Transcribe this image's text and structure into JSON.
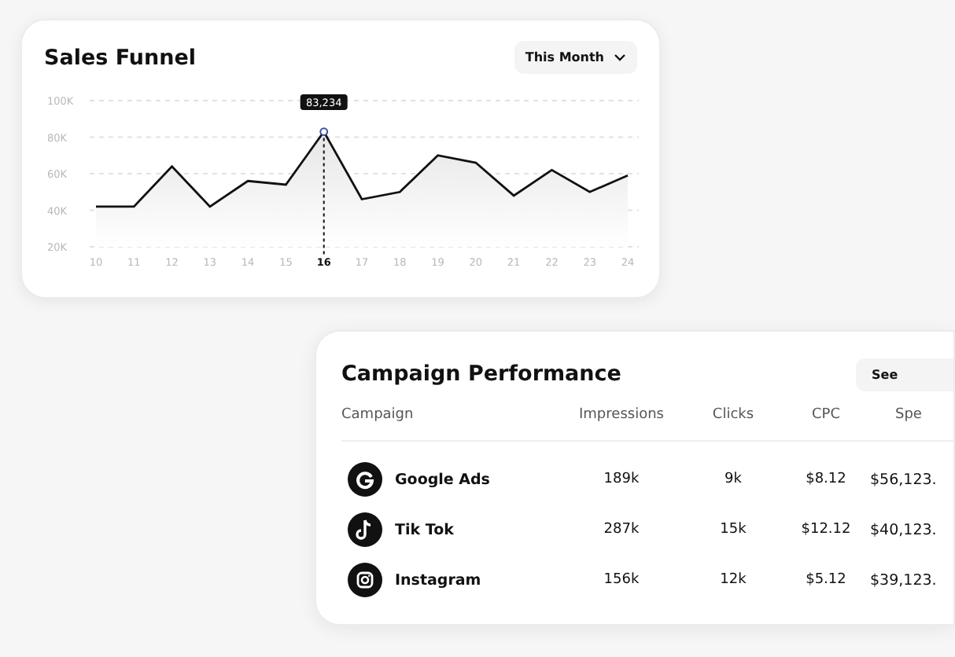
{
  "sales_funnel": {
    "title": "Sales Funnel",
    "period": "This Month",
    "chart_data": {
      "type": "area",
      "categories": [
        "10",
        "11",
        "12",
        "13",
        "14",
        "15",
        "16",
        "17",
        "18",
        "19",
        "20",
        "21",
        "22",
        "23",
        "24"
      ],
      "series": [
        {
          "color": "#111111",
          "values": [
            42,
            42,
            64,
            42,
            56,
            54,
            83,
            46,
            50,
            70,
            66,
            48,
            62,
            50,
            59
          ]
        }
      ],
      "grid": true,
      "ref_lines": [
        {
          "axis": "x",
          "value": "16"
        }
      ],
      "ylim": [
        20,
        100
      ],
      "yticks": [
        {
          "value": 20,
          "label": "20K"
        },
        {
          "value": 40,
          "label": "40K"
        },
        {
          "value": 60,
          "label": "60K"
        },
        {
          "value": 80,
          "label": "80K"
        },
        {
          "value": 100,
          "label": "100K"
        }
      ],
      "annotations": [
        {
          "x": "16",
          "text": "83,234"
        }
      ]
    }
  },
  "campaign_performance": {
    "title": "Campaign Performance",
    "button": "See",
    "columns": [
      "Campaign",
      "Impressions",
      "Clicks",
      "CPC",
      "Spe"
    ],
    "rows": [
      {
        "campaign": "Google Ads",
        "impressions": "189k",
        "clicks": "9k",
        "cpc": "$8.12",
        "spend": "$56,123."
      },
      {
        "campaign": "Tik Tok",
        "impressions": "287k",
        "clicks": "15k",
        "cpc": "$12.12",
        "spend": "$40,123."
      },
      {
        "campaign": "Instagram",
        "impressions": "156k",
        "clicks": "12k",
        "cpc": "$5.12",
        "spend": "$39,123."
      }
    ]
  }
}
